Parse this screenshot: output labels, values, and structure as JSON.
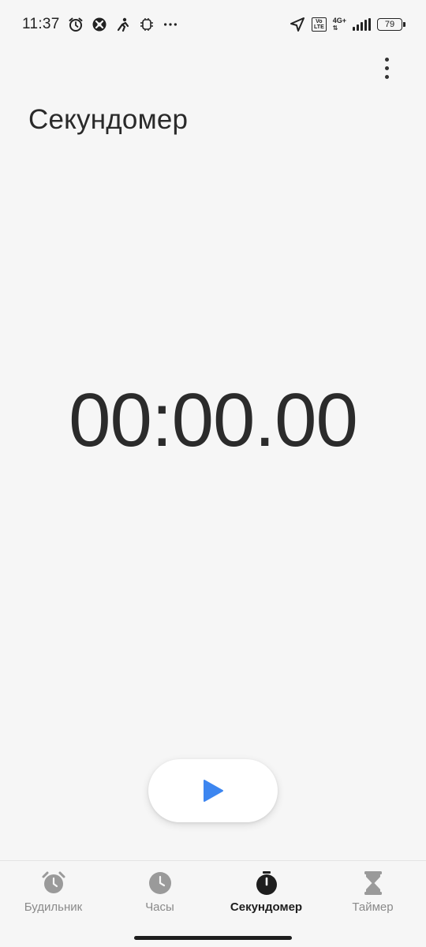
{
  "status_bar": {
    "time": "11:37",
    "left_icons": [
      "alarm-clock-icon",
      "app-notification-icon",
      "activity-icon",
      "misc-notification-icon",
      "more-notifications-icon"
    ],
    "volte_label": "Vo\nLTE",
    "network_type": "4G+",
    "battery_level": "79",
    "icons": [
      "location-arrow-icon",
      "signal-bars-icon",
      "battery-icon"
    ]
  },
  "header": {
    "title": "Секундомер",
    "menu_icon": "more-vert-icon"
  },
  "stopwatch": {
    "display": "00:00.00",
    "start_button_icon": "play-icon"
  },
  "colors": {
    "accent": "#3d86f0",
    "background": "#f6f6f6",
    "active_tab": "#1e1e1e",
    "inactive_tab": "#8a8a8a"
  },
  "bottom_nav": {
    "items": [
      {
        "label": "Будильник",
        "icon": "alarm-icon",
        "active": false
      },
      {
        "label": "Часы",
        "icon": "clock-icon",
        "active": false
      },
      {
        "label": "Секундомер",
        "icon": "stopwatch-icon",
        "active": true
      },
      {
        "label": "Таймер",
        "icon": "hourglass-icon",
        "active": false
      }
    ]
  }
}
